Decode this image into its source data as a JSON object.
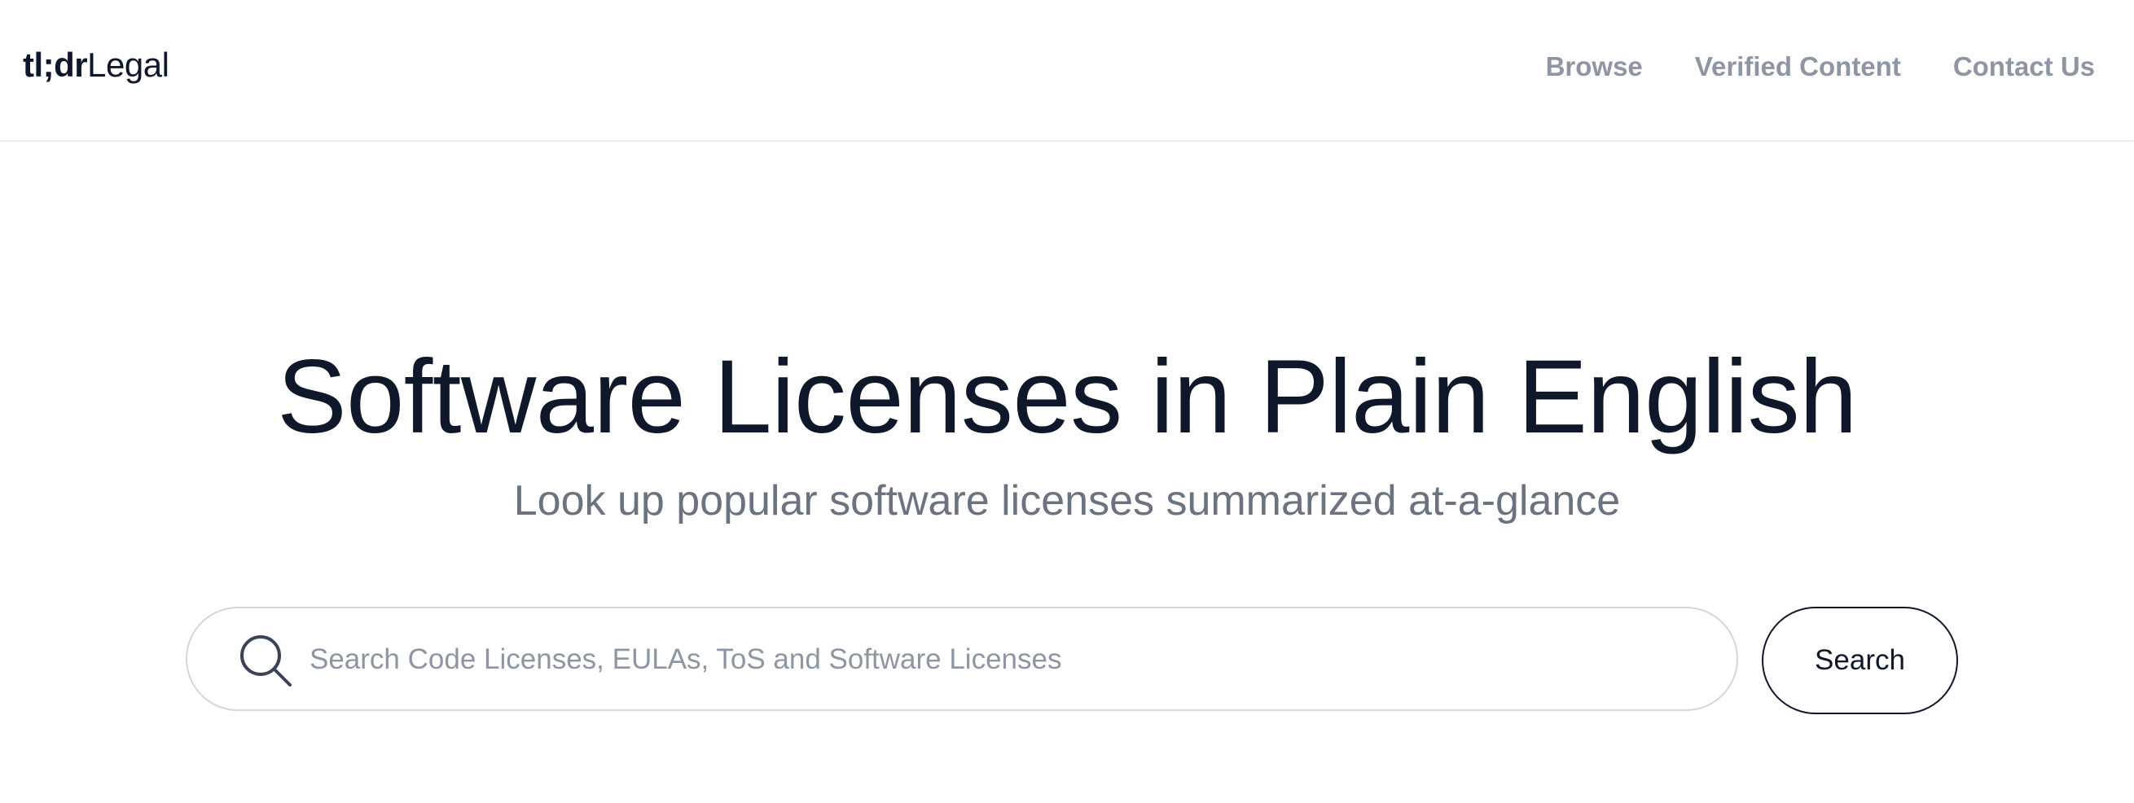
{
  "header": {
    "logo_bold": "tl;dr",
    "logo_light": "Legal",
    "nav": [
      {
        "label": "Browse"
      },
      {
        "label": "Verified Content"
      },
      {
        "label": "Contact Us"
      }
    ]
  },
  "hero": {
    "title": "Software Licenses in Plain English",
    "subtitle": "Look up popular software licenses summarized at-a-glance"
  },
  "search": {
    "placeholder": "Search Code Licenses, EULAs, ToS and Software Licenses",
    "value": "",
    "icon": "search-icon",
    "button_label": "Search"
  },
  "colors": {
    "text_primary": "#0f172a",
    "text_muted": "#8e96a3",
    "subtitle": "#6b7280",
    "border": "#d4d6da"
  }
}
